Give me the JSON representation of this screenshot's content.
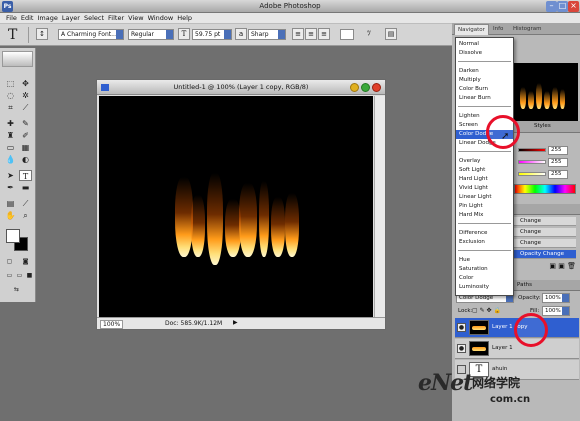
{
  "app": {
    "title": "Adobe Photoshop",
    "icon": "photoshop-app-icon"
  },
  "menu": [
    "File",
    "Edit",
    "Image",
    "Layer",
    "Select",
    "Filter",
    "View",
    "Window",
    "Help"
  ],
  "options": {
    "font_family": "A Charming Font...",
    "font_style": "Regular",
    "font_size": "59.75 pt",
    "anti_alias": "Sharp"
  },
  "document": {
    "title": "Untitled-1 @ 100% (Layer 1 copy, RGB/8)",
    "zoom": "100%",
    "doc_size": "Doc: 585.9K/1.12M"
  },
  "panels": {
    "nav_tabs": [
      "Navigator",
      "Info",
      "Histogram"
    ],
    "color_values": [
      "255",
      "255",
      "255"
    ],
    "history_items": [
      "Change",
      "Change",
      "Change",
      "Opacity Change"
    ],
    "layers_tabs": [
      "Layers",
      "Channels",
      "Paths"
    ],
    "blend_mode": "Color Dodge",
    "opacity_label": "Opacity:",
    "opacity_value": "100%",
    "lock_label": "Lock:",
    "fill_label": "Fill:",
    "fill_value": "100%",
    "layers": [
      {
        "name": "Layer 1 copy",
        "selected": true
      },
      {
        "name": "Layer 1",
        "selected": false
      },
      {
        "name": "ahuin",
        "selected": false
      }
    ]
  },
  "blend_modes": [
    [
      "Normal",
      "Dissolve"
    ],
    [
      "Darken",
      "Multiply",
      "Color Burn",
      "Linear Burn"
    ],
    [
      "Lighten",
      "Screen",
      "Color Dodge",
      "Linear Dodge"
    ],
    [
      "Overlay",
      "Soft Light",
      "Hard Light",
      "Vivid Light",
      "Linear Light",
      "Pin Light",
      "Hard Mix"
    ],
    [
      "Difference",
      "Exclusion"
    ],
    [
      "Hue",
      "Saturation",
      "Color",
      "Luminosity"
    ]
  ],
  "watermark": {
    "brand": "eNet",
    "cn": "网络学院",
    "domain": "com.cn"
  },
  "colors": {
    "selection": "#2f5fd0",
    "highlight_circle": "#e8102a",
    "flame": "#ff9b1a"
  }
}
